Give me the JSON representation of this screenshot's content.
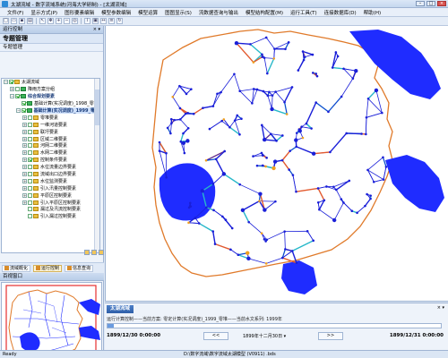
{
  "window": {
    "title": "太湖流域 - 数字流域系统(河海大学研制) - [太湖流域]",
    "min": "–",
    "max": "□",
    "close": "×"
  },
  "menu": [
    "文件(F)",
    "显示方式(P)",
    "图形要素编辑",
    "模型参数编辑",
    "模型运算",
    "图图显示(S)",
    "流数据查询与输出",
    "模型结构配置(M)",
    "运行工具(T)",
    "连接数据库(D)",
    "帮助(H)"
  ],
  "toolbar_icons": [
    "new-icon",
    "open-icon",
    "save-icon",
    "print-icon",
    "pointer-icon",
    "pan-icon",
    "zoom-in-icon",
    "zoom-out-icon",
    "full-extent-icon",
    "identify-icon",
    "select-icon",
    "measure-icon",
    "layer-icon",
    "refresh-icon"
  ],
  "left": {
    "header": "运行控制",
    "pin": "× ▾",
    "section": "专题管理",
    "subsection": "专题管理",
    "tree": [
      {
        "level": 0,
        "exp": "−",
        "chk": true,
        "icon": "folder",
        "label": "太湖流域",
        "bold": false
      },
      {
        "level": 1,
        "exp": "+",
        "chk": false,
        "icon": "green",
        "label": "降雨方案分组",
        "bold": false
      },
      {
        "level": 1,
        "exp": "−",
        "chk": true,
        "icon": "green",
        "label": "综合规划要素",
        "bold": true
      },
      {
        "level": 2,
        "exp": "",
        "chk": true,
        "icon": "green",
        "label": "基础计算(实况调度)_1998_零堆",
        "bold": false
      },
      {
        "level": 2,
        "exp": "−",
        "chk": true,
        "icon": "green",
        "label": "基础计算(实况调度)_1999_零堆",
        "bold": true,
        "sel": true
      },
      {
        "level": 3,
        "exp": "+",
        "chk": false,
        "icon": "folder",
        "label": "零堆要素",
        "bold": false
      },
      {
        "level": 3,
        "exp": "+",
        "chk": false,
        "icon": "folder",
        "label": "一维河道要素",
        "bold": false
      },
      {
        "level": 3,
        "exp": "+",
        "chk": false,
        "icon": "folder",
        "label": "联圩要素",
        "bold": false
      },
      {
        "level": 3,
        "exp": "+",
        "chk": false,
        "icon": "folder",
        "label": "区域二维要素",
        "bold": false
      },
      {
        "level": 3,
        "exp": "+",
        "chk": false,
        "icon": "folder",
        "label": "河网二维要素",
        "bold": false
      },
      {
        "level": 3,
        "exp": "+",
        "chk": false,
        "icon": "folder",
        "label": "水网二维要素",
        "bold": false
      },
      {
        "level": 3,
        "exp": "+",
        "chk": true,
        "icon": "folder",
        "label": "控制条件要素",
        "bold": false
      },
      {
        "level": 3,
        "exp": "+",
        "chk": false,
        "icon": "folder",
        "label": "水位流量边界要素",
        "bold": false
      },
      {
        "level": 3,
        "exp": "+",
        "chk": false,
        "icon": "folder",
        "label": "流域出口边界要素",
        "bold": false
      },
      {
        "level": 3,
        "exp": "+",
        "chk": false,
        "icon": "folder",
        "label": "水位监测要素",
        "bold": false
      },
      {
        "level": 3,
        "exp": "+",
        "chk": false,
        "icon": "folder",
        "label": "引入汛量控制要素",
        "bold": false
      },
      {
        "level": 3,
        "exp": "+",
        "chk": false,
        "icon": "folder",
        "label": "平原区控制要素",
        "bold": false
      },
      {
        "level": 3,
        "exp": "+",
        "chk": false,
        "icon": "folder",
        "label": "引入平原区控制要素",
        "bold": false
      },
      {
        "level": 3,
        "exp": "",
        "chk": false,
        "icon": "folder",
        "label": "漏过及汛流控制要素",
        "bold": false
      },
      {
        "level": 3,
        "exp": "",
        "chk": false,
        "icon": "folder",
        "label": "引入漏过控制要素",
        "bold": false
      }
    ],
    "tabs": [
      {
        "label": "流域概化",
        "active": false
      },
      {
        "label": "运行控制",
        "active": true
      },
      {
        "label": "信息查询",
        "active": false
      }
    ],
    "overview_header": "百视窗口"
  },
  "bottom": {
    "title": "太湖流域",
    "pin": "× ▾",
    "info": "运行计算控制——当前方案: 零定计算(实况调度)_1999_零堆——当前水文系列: 1999年",
    "progress": 0.02,
    "start_time": "1899/12/30 0:00:00",
    "end_time": "1899/12/31 0:00:00",
    "prev_label": "<<",
    "next_label": ">>",
    "current": "1899年十二月30日 ▾"
  },
  "status": {
    "left": "Ready",
    "path": "D:\\数字流域\\数字流域太湖模型 (V0911) .bds"
  },
  "colors": {
    "water": "#1f2cff",
    "boundary": "#e07a2a",
    "node": "#1a1fd8",
    "highlight": "#f0a020"
  }
}
